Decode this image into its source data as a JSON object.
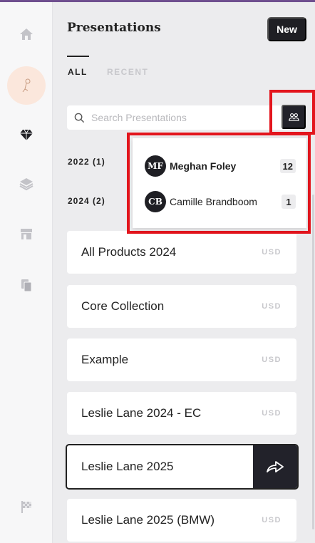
{
  "header": {
    "title": "Presentations",
    "new_label": "New"
  },
  "tabs": [
    {
      "label": "ALL",
      "active": true
    },
    {
      "label": "RECENT",
      "active": false
    }
  ],
  "search": {
    "placeholder": "Search Presentations"
  },
  "years": [
    {
      "label": "2022 (1)"
    },
    {
      "label": "2024 (2)"
    }
  ],
  "owner_filter": {
    "options": [
      {
        "initials": "MF",
        "name": "Meghan Foley",
        "count": "12",
        "selected": true
      },
      {
        "initials": "CB",
        "name": "Camille Brandboom",
        "count": "1",
        "selected": false
      }
    ]
  },
  "presentations": [
    {
      "name": "All Products 2024",
      "currency": "USD"
    },
    {
      "name": "Core Collection",
      "currency": "USD"
    },
    {
      "name": "Example",
      "currency": "USD"
    },
    {
      "name": "Leslie Lane 2024 - EC",
      "currency": "USD"
    },
    {
      "name": "Leslie Lane 2025",
      "currency": "",
      "active": true
    },
    {
      "name": "Leslie Lane 2025 (BMW)",
      "currency": "USD"
    }
  ],
  "icons": {
    "rail": [
      "home-icon",
      "brand-logo",
      "diamond-icon",
      "layers-icon",
      "storefront-icon",
      "documents-icon",
      "checkered-flag-icon"
    ],
    "search": "search-icon",
    "filter": "people-filter-icon",
    "share": "share-arrow-icon"
  },
  "colors": {
    "accent_dark": "#1f1f24",
    "highlight": "#e3151d",
    "top_bar": "#6f4f8f"
  }
}
